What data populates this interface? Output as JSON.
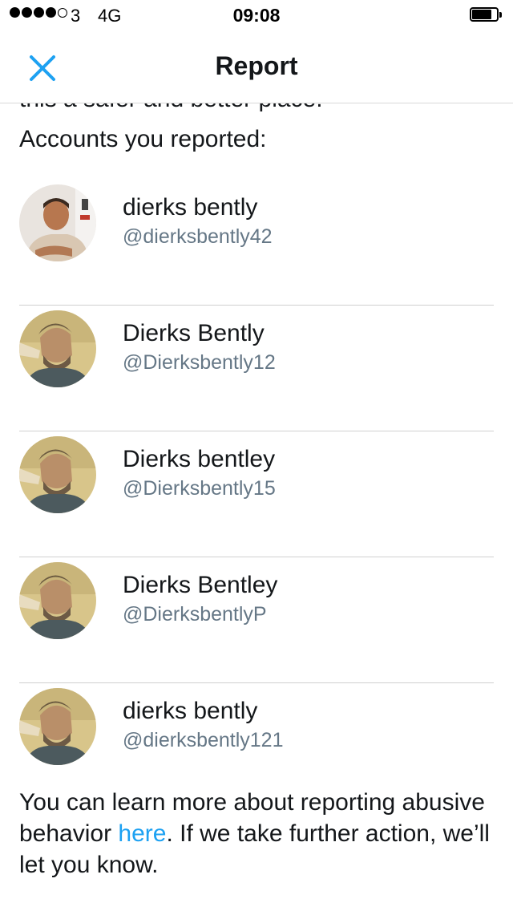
{
  "status_bar": {
    "carrier": "3",
    "network": "4G",
    "time": "09:08"
  },
  "nav": {
    "title": "Report",
    "close_icon": "close-x-icon",
    "accent_color": "#1da1f2"
  },
  "content": {
    "cutoff_text": "this a safer and better place.",
    "heading": "Accounts you reported:",
    "accounts": [
      {
        "name": "dierks bently",
        "handle": "@dierksbently42"
      },
      {
        "name": "Dierks Bently",
        "handle": "@Dierksbently12"
      },
      {
        "name": "Dierks bentley",
        "handle": "@Dierksbently15"
      },
      {
        "name": "Dierks Bentley",
        "handle": "@DierksbentlyP"
      },
      {
        "name": "dierks bently",
        "handle": "@dierksbently121"
      }
    ],
    "footer": {
      "before_link": "You can learn more about reporting abusive behavior ",
      "link": "here",
      "after_link": ". If we take further action, we’ll let you know."
    }
  }
}
